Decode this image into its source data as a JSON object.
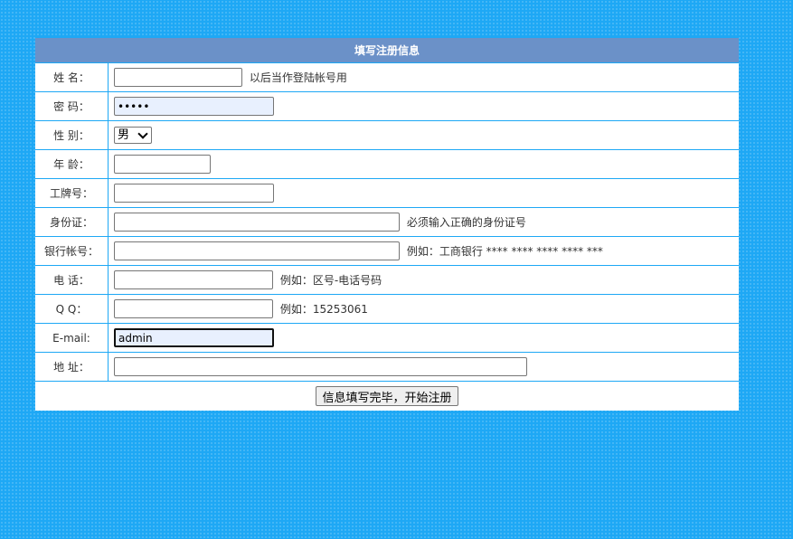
{
  "form": {
    "title": "填写注册信息",
    "fields": [
      {
        "label": "姓 名：",
        "value": "",
        "hint": "以后当作登陆帐号用"
      },
      {
        "label": "密 码：",
        "value": "•••••",
        "hint": ""
      },
      {
        "label": "性 别：",
        "value": "男",
        "hint": ""
      },
      {
        "label": "年 龄：",
        "value": "",
        "hint": ""
      },
      {
        "label": "工牌号：",
        "value": "",
        "hint": ""
      },
      {
        "label": "身份证：",
        "value": "",
        "hint": "必须输入正确的身份证号"
      },
      {
        "label": "银行帐号：",
        "value": "",
        "hint": "例如：工商银行 **** **** **** **** ***"
      },
      {
        "label": "电 话：",
        "value": "",
        "hint": "例如：区号-电话号码"
      },
      {
        "label": "Q Q：",
        "value": "",
        "hint": "例如：15253061"
      },
      {
        "label": "E-mail:",
        "value": "admin",
        "hint": ""
      },
      {
        "label": "地 址：",
        "value": "",
        "hint": ""
      }
    ],
    "gender_selected": "男",
    "submit_label": "信息填写完毕，开始注册"
  }
}
